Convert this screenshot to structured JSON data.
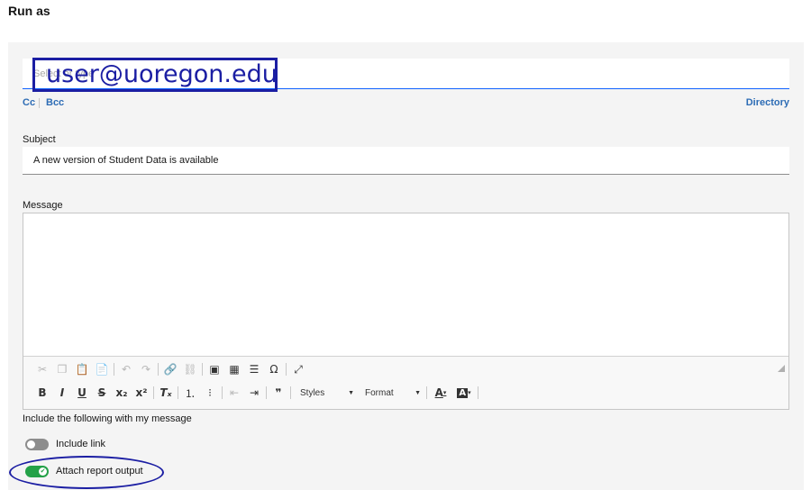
{
  "page": {
    "heading": "Run as"
  },
  "to": {
    "placeholder": "Select or type",
    "value": "user@uoregon.edu"
  },
  "recipients": {
    "cc": "Cc",
    "bcc": "Bcc",
    "directory": "Directory"
  },
  "subject": {
    "label": "Subject",
    "value": "A new version of Student Data is available"
  },
  "message": {
    "label": "Message",
    "body": ""
  },
  "editor_toolbar": {
    "row1": [
      "cut-icon",
      "copy-icon",
      "paste-icon",
      "paste-text-icon",
      "undo-icon",
      "redo-icon",
      "link-icon",
      "unlink-icon",
      "image-icon",
      "table-icon",
      "horizontal-line-icon",
      "special-char-icon",
      "maximize-icon"
    ],
    "row2": [
      "bold-icon",
      "italic-icon",
      "underline-icon",
      "strikethrough-icon",
      "subscript-icon",
      "superscript-icon",
      "remove-format-icon",
      "numbered-list-icon",
      "bulleted-list-icon",
      "outdent-icon",
      "indent-icon",
      "blockquote-icon"
    ],
    "styles_label": "Styles",
    "format_label": "Format"
  },
  "include": {
    "label": "Include the following with my message",
    "include_link": {
      "label": "Include link",
      "enabled": false
    },
    "attach_output": {
      "label": "Attach report output",
      "enabled": true
    }
  },
  "colors": {
    "accent": "#0f62fe",
    "annotation": "#1b1ea3",
    "toggle_on": "#24a148",
    "link": "#2d6cb5"
  }
}
